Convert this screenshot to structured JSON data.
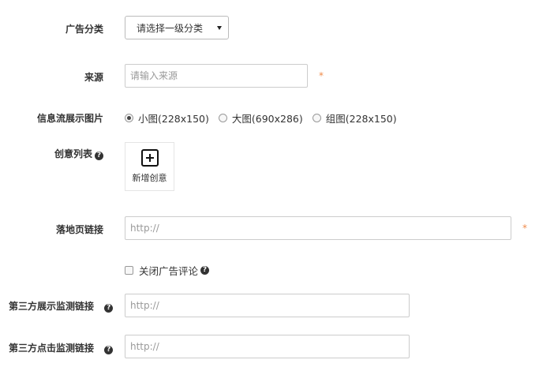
{
  "category": {
    "label": "广告分类",
    "selected": "请选择一级分类"
  },
  "source": {
    "label": "来源",
    "placeholder": "请输入来源",
    "required_mark": "*"
  },
  "feed_image": {
    "label": "信息流展示图片",
    "options": [
      {
        "label": "小图(228x150)",
        "selected": true
      },
      {
        "label": "大图(690x286)",
        "selected": false
      },
      {
        "label": "组图(228x150)",
        "selected": false
      }
    ]
  },
  "creative_list": {
    "label": "创意列表",
    "add_label": "新增创意"
  },
  "landing_page": {
    "label": "落地页链接",
    "placeholder": "http://",
    "required_mark": "*"
  },
  "close_comments": {
    "label": "关闭广告评论",
    "checked": false
  },
  "impression_tracking": {
    "label": "第三方展示监测链接",
    "placeholder": "http://"
  },
  "click_tracking": {
    "label": "第三方点击监测链接",
    "placeholder": "http://"
  },
  "help_glyph": "?",
  "colors": {
    "required": "#f08b4a",
    "border": "#cccccc",
    "text": "#333333"
  }
}
